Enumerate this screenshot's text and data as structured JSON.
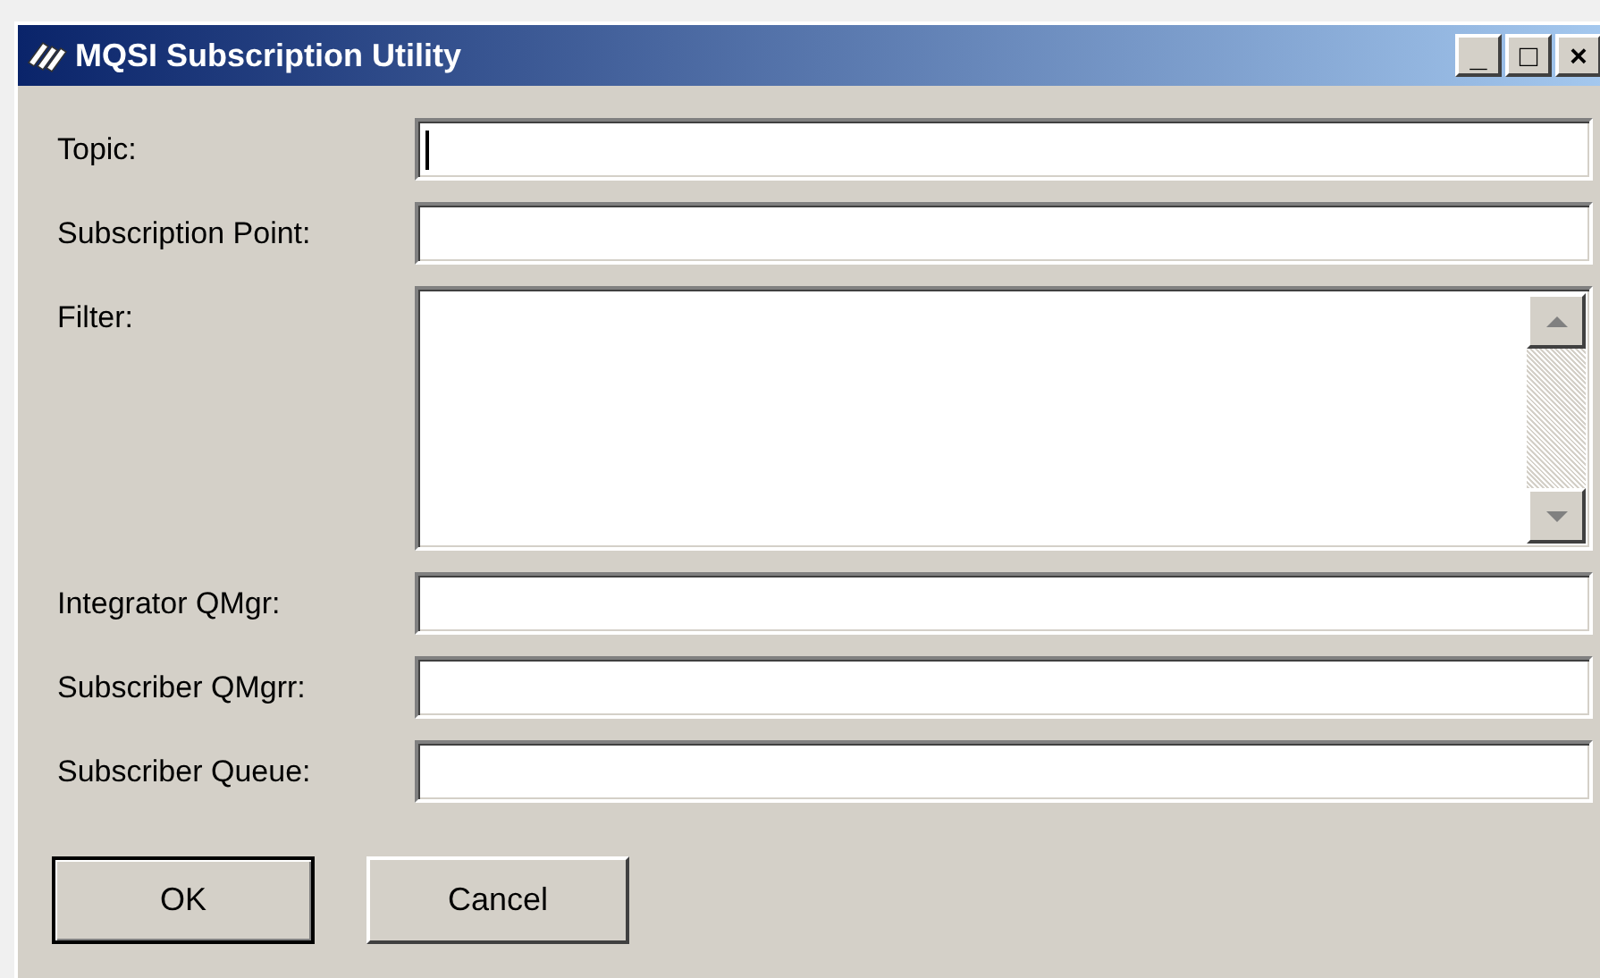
{
  "window": {
    "title": "MQSI Subscription Utility",
    "controls": [
      "_",
      "□",
      "×"
    ]
  },
  "fields": [
    {
      "label": "Topic:",
      "kind": "text",
      "focused": true
    },
    {
      "label": "Subscription Point:",
      "kind": "text",
      "focused": false
    },
    {
      "label": "Filter:",
      "kind": "textarea",
      "focused": false
    },
    {
      "label": "Integrator QMgr:",
      "kind": "text",
      "focused": false
    },
    {
      "label": "Subscriber QMgrr:",
      "kind": "text",
      "focused": false
    },
    {
      "label": "Subscriber Queue:",
      "kind": "text",
      "focused": false
    }
  ],
  "buttons": [
    {
      "label": "OK",
      "default": true
    },
    {
      "label": "Cancel",
      "default": false
    }
  ]
}
